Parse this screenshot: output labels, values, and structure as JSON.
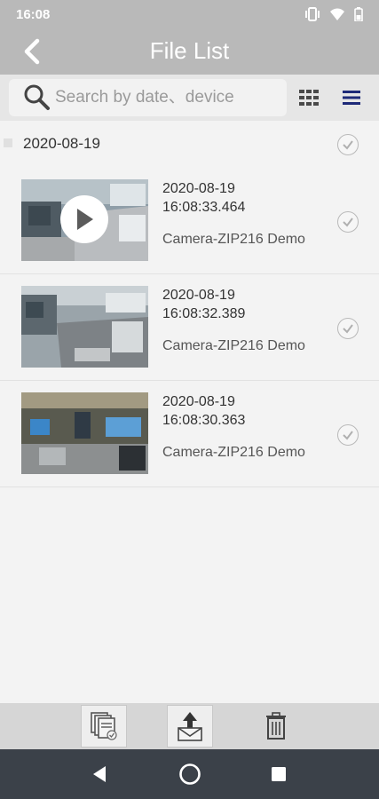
{
  "status_bar": {
    "time": "16:08"
  },
  "header": {
    "title": "File List"
  },
  "search": {
    "placeholder": "Search by date、device"
  },
  "groups": [
    {
      "date": "2020-08-19",
      "items": [
        {
          "date": "2020-08-19",
          "time": "16:08:33.464",
          "device": "Camera-ZIP216 Demo",
          "is_video": true
        },
        {
          "date": "2020-08-19",
          "time": "16:08:32.389",
          "device": "Camera-ZIP216 Demo",
          "is_video": false
        },
        {
          "date": "2020-08-19",
          "time": "16:08:30.363",
          "device": "Camera-ZIP216 Demo",
          "is_video": false
        }
      ]
    }
  ],
  "icons": {
    "status": [
      "vibrate-icon",
      "wifi-icon",
      "battery-icon"
    ],
    "view_modes": [
      "grid-view-icon",
      "list-view-icon"
    ],
    "toolbar": [
      "select-all-icon",
      "share-icon",
      "trash-icon"
    ],
    "nav": [
      "nav-back-icon",
      "nav-home-icon",
      "nav-recents-icon"
    ]
  },
  "colors": {
    "header_bg": "#b9b9b9",
    "accent_list_icon": "#1e2a78",
    "nav_bg": "#3b4149"
  }
}
